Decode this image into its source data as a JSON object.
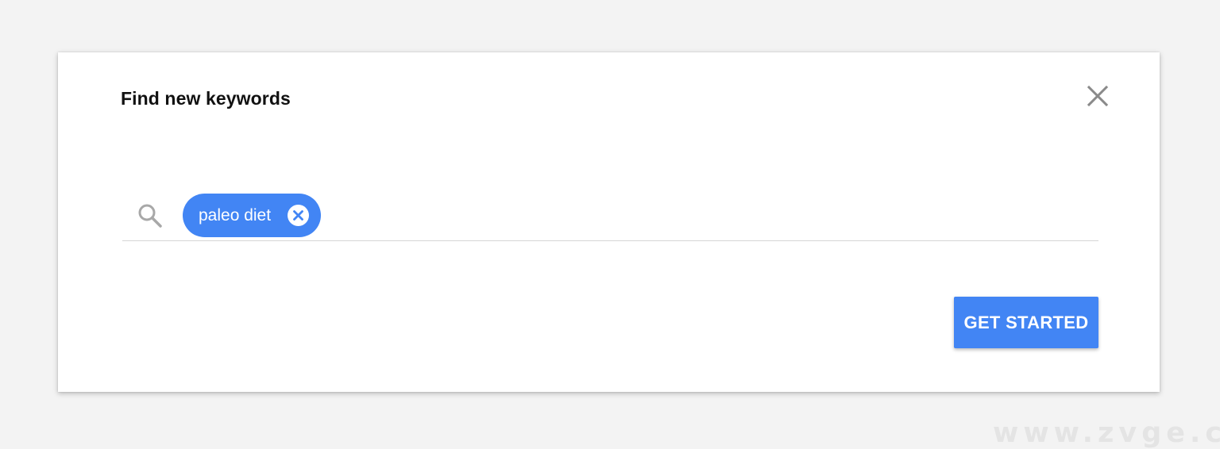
{
  "dialog": {
    "title": "Find new keywords",
    "close_icon": "close-icon",
    "search": {
      "icon": "search-icon",
      "chips": [
        {
          "label": "paleo diet",
          "remove_icon": "cancel-circle-icon"
        }
      ]
    },
    "primary_button_label": "GET STARTED"
  },
  "watermark": "www.zvge.cn",
  "colors": {
    "accent": "#4285f4",
    "page_background": "#f3f3f3",
    "dialog_background": "#ffffff",
    "icon_gray": "#9e9e9e",
    "divider": "#d5d5d5"
  }
}
